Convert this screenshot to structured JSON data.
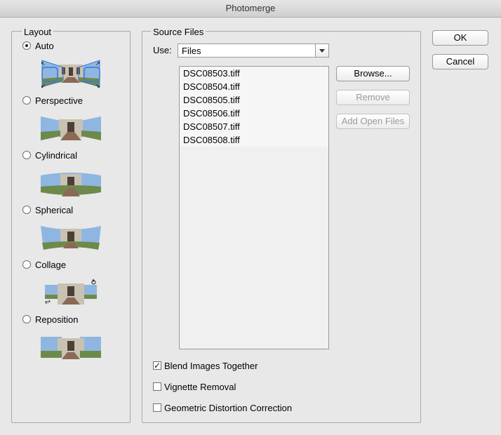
{
  "window": {
    "title": "Photomerge"
  },
  "layout": {
    "label": "Layout",
    "options": [
      {
        "label": "Auto",
        "selected": true,
        "thumb": "auto-layout-preview"
      },
      {
        "label": "Perspective",
        "selected": false,
        "thumb": "perspective-layout-preview"
      },
      {
        "label": "Cylindrical",
        "selected": false,
        "thumb": "cylindrical-layout-preview"
      },
      {
        "label": "Spherical",
        "selected": false,
        "thumb": "spherical-layout-preview"
      },
      {
        "label": "Collage",
        "selected": false,
        "thumb": "collage-layout-preview"
      },
      {
        "label": "Reposition",
        "selected": false,
        "thumb": "reposition-layout-preview"
      }
    ]
  },
  "source": {
    "label": "Source Files",
    "use_label": "Use:",
    "use_value": "Files",
    "files": [
      "DSC08503.tiff",
      "DSC08504.tiff",
      "DSC08505.tiff",
      "DSC08506.tiff",
      "DSC08507.tiff",
      "DSC08508.tiff"
    ],
    "browse_label": "Browse...",
    "remove_label": "Remove",
    "add_open_label": "Add Open Files"
  },
  "options": {
    "blend": {
      "label": "Blend Images Together",
      "checked": true
    },
    "vignette": {
      "label": "Vignette Removal",
      "checked": false
    },
    "geometric": {
      "label": "Geometric Distortion Correction",
      "checked": false
    }
  },
  "actions": {
    "ok_label": "OK",
    "cancel_label": "Cancel"
  },
  "colors": {
    "sky": "#8fb6e0",
    "lawn": "#6e8a4a",
    "building": "#c9c2b3",
    "path": "#8a6a55",
    "selection": "#3a78d8"
  }
}
